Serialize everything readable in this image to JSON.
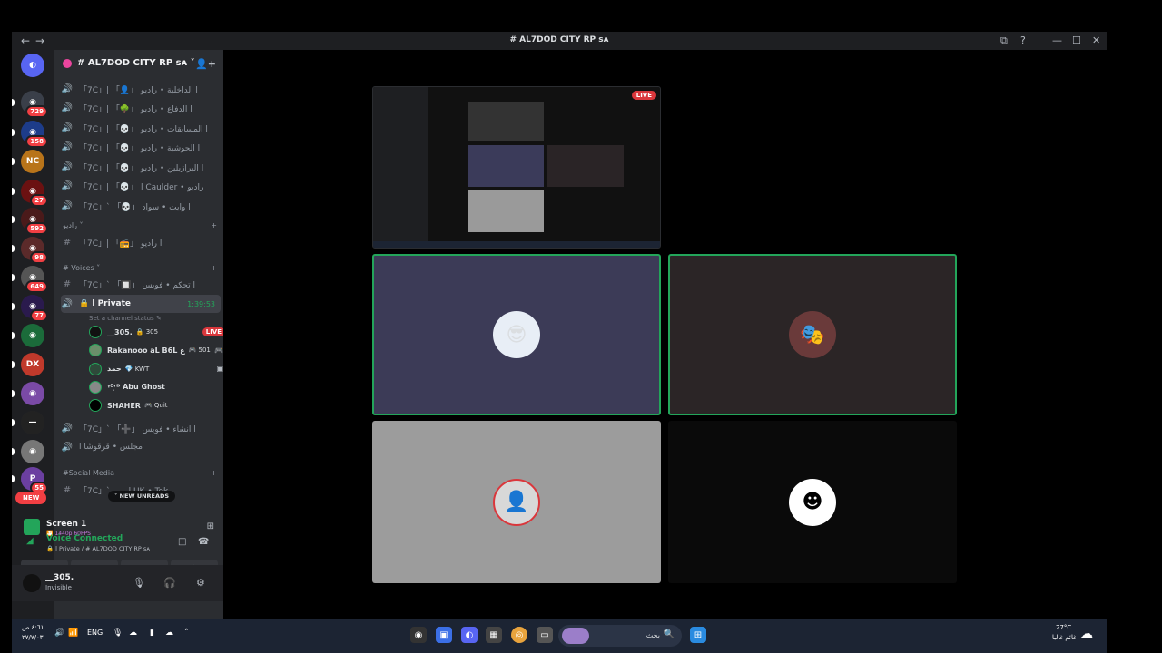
{
  "window": {
    "title": "# AL7DOD CITY RP ꜱᴀ",
    "back_label": "←",
    "forward_label": "→",
    "title_icon": "server-icon",
    "controls": [
      "⧉",
      "?",
      "—",
      "☐",
      "✕"
    ]
  },
  "rail": {
    "home_icon": "discord-icon",
    "servers": [
      {
        "badge": "729",
        "color": "#3a3f49",
        "glyph": "◉"
      },
      {
        "badge": "158",
        "color": "#1d3c8a",
        "glyph": "◉"
      },
      {
        "badge": "",
        "color": "#b8741a",
        "glyph": "NC"
      },
      {
        "badge": "27",
        "color": "#6b1111",
        "glyph": "◉"
      },
      {
        "badge": "592",
        "color": "#4a1a1a",
        "glyph": "◉"
      },
      {
        "badge": "98",
        "color": "#5b2a2a",
        "glyph": "◉"
      },
      {
        "badge": "649",
        "color": "#555",
        "glyph": "◉"
      },
      {
        "badge": "77",
        "color": "#2a1a4d",
        "glyph": "◉"
      },
      {
        "badge": "",
        "color": "#1b6b3a",
        "glyph": "◉"
      },
      {
        "badge": "",
        "color": "#c0392b",
        "glyph": "DX"
      },
      {
        "badge": "",
        "color": "#7a4aa6",
        "glyph": "◉"
      },
      {
        "badge": "",
        "color": "#222",
        "glyph": "—"
      },
      {
        "badge": "",
        "color": "#777",
        "glyph": "◉"
      },
      {
        "badge": "55",
        "color": "#6b3fa0",
        "glyph": "P"
      }
    ],
    "new_label": "NEW"
  },
  "sidebar": {
    "guild_name": "# AL7DOD CITY RP ꜱᴀ ˅",
    "channels_top": [
      {
        "icon": "🔊",
        "name": "「7C」| 「👤」 ا الداخلية • راديو"
      },
      {
        "icon": "🔊",
        "name": "「7C」| 「🌳」 ا الدفاع • راديو"
      },
      {
        "icon": "🔊",
        "name": "「7C」| 「💀」 ا المسابقات • راديو"
      },
      {
        "icon": "🔊",
        "name": "「7C」| 「💀」 ا الحوشية • راديو"
      },
      {
        "icon": "🔊",
        "name": "「7C」| 「💀」 ا البرازيلين • راديو"
      },
      {
        "icon": "🔊",
        "name": "「7C」| 「💀」 ا Caulder • راديو"
      },
      {
        "icon": "🔊",
        "name": "「7C」ˋ 「💀」 ا وايت • سواد"
      }
    ],
    "cat_radio": "راديو ˅",
    "radio_channel": {
      "icon": "#",
      "name": "「7C」| 「📻」 ا راديو"
    },
    "cat_voices": "# Voices ˅",
    "voice_channel_1": {
      "icon": "#",
      "name": "「7C」ˋ 「🔲」 ا تحكم • فويس"
    },
    "private_channel": {
      "icon": "🔊",
      "name": "🔒 ا Private",
      "time": "1:39:53"
    },
    "set_status": "Set a channel status ✎",
    "users": [
      {
        "name": "__305.",
        "tag": "🔒 305",
        "live": "LIVE"
      },
      {
        "name": "Rakanooo aL B6L ع",
        "tag": "🎮 501",
        "side": "🎮"
      },
      {
        "name": "حمد",
        "tag": "💎 KWT",
        "side": "▣"
      },
      {
        "name": "ᵞᴼ᷂ʳᴰ Abu Ghost",
        "tag": ""
      },
      {
        "name": "SHAHER",
        "tag": "🎮 Quit"
      }
    ],
    "voice_channel_2": {
      "icon": "🔊",
      "name": "「7C」ˋ 「➕」 ا انشاء • فويس"
    },
    "voice_channel_3": {
      "icon": "🔊",
      "name": "مجلس • قرقوشا ا"
    },
    "cat_social": "#Social Media",
    "social_channel": {
      "icon": "#",
      "name": "「7C」ˋ ، ... ا UK • Tok"
    },
    "new_unreads": "NEW UNREADS",
    "add": "+"
  },
  "stream_panel": {
    "title": "Screen 1",
    "sub": "🎦 1440p 60FPS",
    "icon": "⊞"
  },
  "voice_panel": {
    "title": "Voice Connected",
    "sub": "🔒 ا Private / # AL7DOD CITY RP ꜱᴀ",
    "wave_icon": "◫",
    "hangup_icon": "☎",
    "buttons": [
      "▧",
      "⧈",
      "⁘",
      "✧"
    ]
  },
  "me": {
    "name": "__305.",
    "status": "Invisible",
    "mic": "🎙",
    "headset": "🎧",
    "settings": "⚙"
  },
  "stage": {
    "live_label": "LIVE"
  },
  "taskbar": {
    "time": "٤:٦١ ص",
    "date": "٢٧/٧/٠٣",
    "lang": "ENG",
    "search_label": "بحث",
    "search_icon": "🔍",
    "weather_temp": "27°C",
    "weather_label": "غائم غالبا",
    "tray_icons": [
      "🔊",
      "📶"
    ]
  }
}
